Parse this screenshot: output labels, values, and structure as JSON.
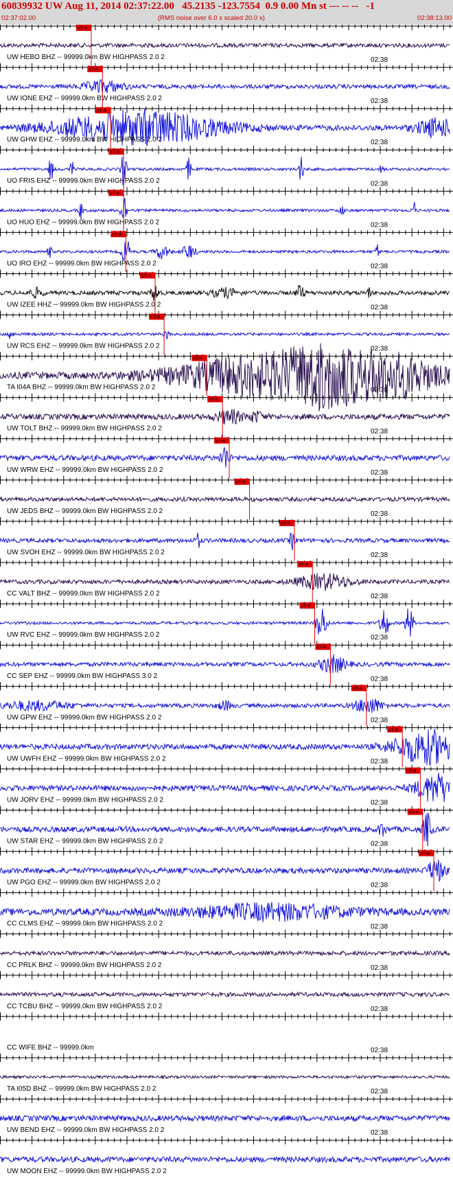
{
  "header": {
    "title": "60839932 UW Aug 11, 2014 02:37:22.00   45.2135 -123.7554  0.9 0.00 Mn st --- -- --   -1",
    "start_time": "02:37:02.00",
    "noise_note": "(RMS noise over 6.0 s scaled 20.0 x)",
    "end_time": "02:38:13.00"
  },
  "chart_data": {
    "type": "seismogram",
    "minute_label": "02:38",
    "pick_label": "xT-4",
    "colors": {
      "blue": "#1414dc",
      "dark": "#2a1050",
      "black": "#111111",
      "pick": "#e00000",
      "tick": "#000000"
    },
    "traces": [
      {
        "label": "UW HEBO BHZ -- 99999.0km BW  HIGHPASS  2.0  2",
        "color": "dark",
        "pick": 0.203,
        "amp": 3,
        "bursts": []
      },
      {
        "label": "UW IONE EHZ -- 99999.0km BW  HIGHPASS  2.0  2",
        "color": "blue",
        "pick": 0.228,
        "amp": 3,
        "bursts": [
          [
            0.23,
            0.03,
            8
          ]
        ]
      },
      {
        "label": "UW GHW EHZ -- 99999.0km BW  HIGHPASS  2.0  2",
        "color": "blue",
        "pick": 0.246,
        "amp": 4,
        "bursts": [
          [
            0.31,
            0.12,
            24
          ],
          [
            0.97,
            0.03,
            12
          ]
        ]
      },
      {
        "label": "UO FRIS EHZ -- 99999.0km BW  HIGHPASS  2.0  2",
        "color": "blue",
        "pick": 0.275,
        "amp": 2,
        "bursts": [
          [
            0.113,
            0.003,
            22
          ],
          [
            0.275,
            0.004,
            26
          ],
          [
            0.42,
            0.003,
            20
          ],
          [
            0.67,
            0.003,
            22
          ],
          [
            0.16,
            0.003,
            12
          ],
          [
            0.85,
            0.003,
            10
          ]
        ]
      },
      {
        "label": "UO HUO EHZ -- 99999.0km BW  HIGHPASS  2.0  2",
        "color": "blue",
        "pick": 0.275,
        "amp": 2,
        "bursts": [
          [
            0.275,
            0.004,
            30
          ],
          [
            0.18,
            0.003,
            12
          ],
          [
            0.92,
            0.003,
            14
          ],
          [
            0.76,
            0.003,
            10
          ]
        ]
      },
      {
        "label": "UO IRO EHZ -- 99999.0km BW  HIGHPASS  2.0  2",
        "color": "blue",
        "pick": 0.28,
        "amp": 2,
        "bursts": [
          [
            0.28,
            0.006,
            20
          ],
          [
            0.36,
            0.01,
            10
          ],
          [
            0.42,
            0.01,
            10
          ],
          [
            0.11,
            0.003,
            10
          ],
          [
            0.84,
            0.003,
            10
          ]
        ]
      },
      {
        "label": "UW IZEE HHZ -- 99999.0km BW  HIGHPASS  2.0  2",
        "color": "black",
        "pick": 0.345,
        "amp": 3,
        "bursts": [
          [
            0.345,
            0.006,
            12
          ],
          [
            0.668,
            0.006,
            10
          ],
          [
            0.82,
            0.003,
            8
          ],
          [
            0.08,
            0.01,
            6
          ],
          [
            0.5,
            0.02,
            6
          ]
        ]
      },
      {
        "label": "UW RCS EHZ -- 99999.0km BW  HIGHPASS  2.0  2",
        "color": "blue",
        "pick": 0.365,
        "amp": 2,
        "bursts": [
          [
            0.024,
            0.004,
            8
          ],
          [
            0.37,
            0.004,
            6
          ]
        ]
      },
      {
        "label": "TA I04A BHZ -- 99999.0km BW  HIGHPASS  2.0  2",
        "color": "dark",
        "pick": 0.46,
        "amp": 5,
        "bursts": [
          [
            0.6,
            0.14,
            30
          ],
          [
            0.87,
            0.08,
            28
          ],
          [
            0.72,
            0.05,
            24
          ]
        ]
      },
      {
        "label": "UW TOLT BHZ -- 99999.0km BW  HIGHPASS  2.0  2",
        "color": "dark",
        "pick": 0.495,
        "amp": 4,
        "bursts": [
          [
            0.51,
            0.02,
            9
          ],
          [
            0.57,
            0.01,
            7
          ]
        ]
      },
      {
        "label": "UW WRW EHZ -- 99999.0km BW  HIGHPASS  2.0  2",
        "color": "blue",
        "pick": 0.51,
        "amp": 4,
        "bursts": [
          [
            0.5,
            0.006,
            18
          ]
        ]
      },
      {
        "label": "UW JEDS BHZ -- 99999.0km BW  HIGHPASS  2.0  2",
        "color": "dark",
        "pick": 0.555,
        "amp": 3,
        "bursts": []
      },
      {
        "label": "UW SVOH EHZ -- 99999.0km BW  HIGHPASS  2.0  2",
        "color": "blue",
        "pick": 0.655,
        "amp": 3,
        "bursts": [
          [
            0.44,
            0.004,
            10
          ],
          [
            0.65,
            0.004,
            12
          ]
        ]
      },
      {
        "label": "CC VALT BHZ -- 99999.0km BW  HIGHPASS  2.0  2",
        "color": "dark",
        "pick": 0.695,
        "amp": 3,
        "bursts": [
          [
            0.72,
            0.04,
            11
          ]
        ]
      },
      {
        "label": "UW RVC EHZ -- 99999.0km BW  HIGHPASS  2.0  2",
        "color": "blue",
        "pick": 0.7,
        "amp": 2,
        "bursts": [
          [
            0.715,
            0.008,
            24
          ],
          [
            0.855,
            0.006,
            26
          ],
          [
            0.91,
            0.006,
            24
          ]
        ]
      },
      {
        "label": "CC SEP EHZ -- 99999.0km BW  HIGHPASS  3.0  2",
        "color": "blue",
        "pick": 0.735,
        "amp": 3,
        "bursts": [
          [
            0.74,
            0.02,
            12
          ]
        ]
      },
      {
        "label": "UW GPW EHZ -- 99999.0km BW  HIGHPASS  2.0  2",
        "color": "blue",
        "pick": 0.815,
        "amp": 3,
        "bursts": [
          [
            0.82,
            0.02,
            11
          ],
          [
            0.08,
            0.05,
            6
          ],
          [
            0.5,
            0.01,
            6
          ]
        ]
      },
      {
        "label": "UW UWFH EHZ -- 99999.0km BW  HIGHPASS  2.0  2",
        "color": "blue",
        "pick": 0.895,
        "amp": 4,
        "bursts": [
          [
            0.95,
            0.05,
            24
          ]
        ]
      },
      {
        "label": "UW JORV EHZ -- 99999.0km BW  HIGHPASS  2.0  2",
        "color": "blue",
        "pick": 0.935,
        "amp": 4,
        "bursts": [
          [
            0.97,
            0.03,
            20
          ]
        ]
      },
      {
        "label": "UW STAR EHZ -- 99999.0km BW  HIGHPASS  2.0  2",
        "color": "blue",
        "pick": 0.94,
        "amp": 4,
        "bursts": [
          [
            0.95,
            0.006,
            26
          ],
          [
            0.85,
            0.005,
            10
          ]
        ]
      },
      {
        "label": "UW PGO EHZ -- 99999.0km BW  HIGHPASS  2.0  2",
        "color": "blue",
        "pick": 0.965,
        "amp": 4,
        "bursts": [
          [
            0.97,
            0.012,
            16
          ]
        ]
      },
      {
        "label": "CC CLMS EHZ -- 99999.0km BW  HIGHPASS  2.0  2",
        "color": "blue",
        "pick": null,
        "amp": 5,
        "bursts": [
          [
            0.6,
            0.12,
            10
          ]
        ]
      },
      {
        "label": "CC PRLK BHZ -- 99999.0km BW  HIGHPASS  2.0  2",
        "color": "dark",
        "pick": null,
        "amp": 3,
        "bursts": []
      },
      {
        "label": "CC TCBU BHZ -- 99999.0km BW  HIGHPASS  2.0  2",
        "color": "dark",
        "pick": null,
        "amp": 3,
        "bursts": []
      },
      {
        "label": "CC WIFE BHZ -- 99999.0km",
        "color": "none",
        "pick": null,
        "amp": 0,
        "bursts": []
      },
      {
        "label": "TA I05D BHZ -- 99999.0km BW  HIGHPASS  2.0  2",
        "color": "dark",
        "pick": null,
        "amp": 2,
        "bursts": []
      },
      {
        "label": "UW BEND EHZ -- 99999.0km BW  HIGHPASS  2.0  2",
        "color": "blue",
        "pick": null,
        "amp": 4,
        "bursts": []
      },
      {
        "label": "UW MOON EHZ -- 99999.0km BW  HIGHPASS  2.0  2",
        "color": "blue",
        "pick": null,
        "amp": 4,
        "bursts": []
      }
    ]
  }
}
